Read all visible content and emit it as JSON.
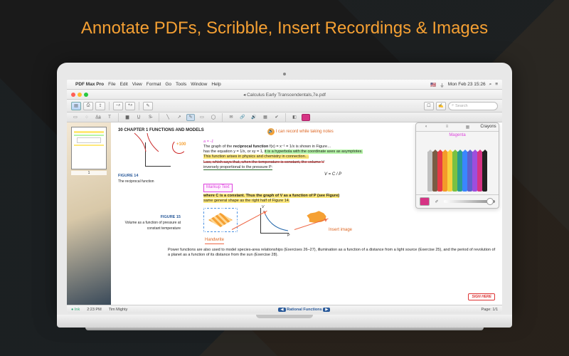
{
  "headline": "Annotate PDFs, Scribble, Insert Recordings & Images",
  "menubar": {
    "app_name": "PDF Max Pro",
    "items": [
      "File",
      "Edit",
      "View",
      "Format",
      "Go",
      "Tools",
      "Window",
      "Help"
    ],
    "clock": "Mon Feb 23  15:26",
    "flag": "🇺🇸"
  },
  "window": {
    "doc_title": "Calculus Early Transcendentals,7e.pdf"
  },
  "search": {
    "placeholder": "Search"
  },
  "thumbs": {
    "page_num": "1"
  },
  "page": {
    "header": "30      CHAPTER 1   FUNCTIONS AND MODELS",
    "record_note": "I can record while taking notes",
    "para1_a": "a = -1",
    "para1_b": "The graph of the ",
    "para1_c": "reciprocal function",
    "para1_d": " f(x) = x⁻¹ = 1/x is shown in Figure…",
    "para1_e": "has the equation y = 1/x, or xy = 1, ",
    "para1_f": "it is a hyperbola with the coordinate axes as asymptotes.",
    "para1_g": "This function arises in physics and chemistry in connection…",
    "para1_h": "Law, which says that, when the temperature is constant, the volume V",
    "para1_i": "inversely proportional to the pressure P:",
    "formula1": "V = C / P",
    "fig14": "FIGURE 14",
    "fig14_cap": "The reciprocal function",
    "markup": "Markup Text",
    "para2_a": "where C is a constant. Thus the graph of V as a function of P (see Figure)",
    "para2_b": "same general shape as the right half of Figure 14.",
    "fig15": "FIGURE 15",
    "fig15_cap": "Volume as a function of pressure at constant temperature",
    "handwrite": "Handwrite",
    "insert_img": "Insert image",
    "plus100": "+100",
    "para3": "Power functions are also used to model species-area relationships (Exercises 26–27), illumination as a function of a distance from a light source (Exercise 25), and the period of revolution of a planet as a function of its distance from the sun (Exercise 28).",
    "stamp": "SIGN HERE"
  },
  "palette": {
    "tab_crayons": "Crayons",
    "label": "Magenta",
    "colors": [
      "#c0c0c0",
      "#7a5c44",
      "#e63946",
      "#f49b2a",
      "#f7d23e",
      "#7ac142",
      "#2a9d8f",
      "#3a86ff",
      "#5e60ce",
      "#9d4edd",
      "#d63384",
      "#222"
    ],
    "swatch": "#d63384"
  },
  "statusbar": {
    "ink": "Ink",
    "time": "2:23 PM",
    "user": "Tim Mighty",
    "section": "Rational Functions",
    "page": "Page: 1/1"
  }
}
